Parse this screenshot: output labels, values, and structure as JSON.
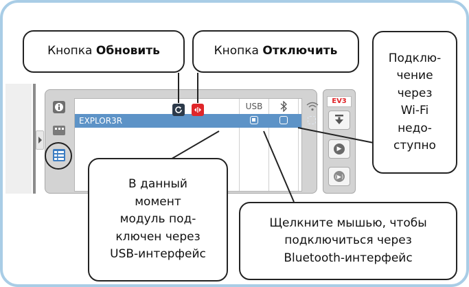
{
  "panel": {
    "columns": {
      "usb": "USB",
      "bluetooth": "ᛒ"
    },
    "brick_name": "EXPLOR3R",
    "ev3_label": "EV3"
  },
  "callouts": {
    "refresh_prefix": "Кнопка",
    "refresh_strong": "Обновить",
    "disconnect_prefix": "Кнопка",
    "disconnect_strong": "Отключить",
    "wifi": [
      "Подклю-",
      "чение",
      "через",
      "Wi-Fi",
      "недо-",
      "ступно"
    ],
    "usb": [
      "В данный",
      "момент",
      "модуль под-",
      "ключен через",
      "USB-интерфейс"
    ],
    "bluetooth": [
      "Щелкните мышью, чтобы",
      "подключиться через",
      "Bluetooth-интерфейс"
    ]
  },
  "colors": {
    "frame": "#a9cde6",
    "selected_row": "#5d93c7",
    "disconnect": "#e0262a",
    "refresh": "#2c3a4a"
  }
}
